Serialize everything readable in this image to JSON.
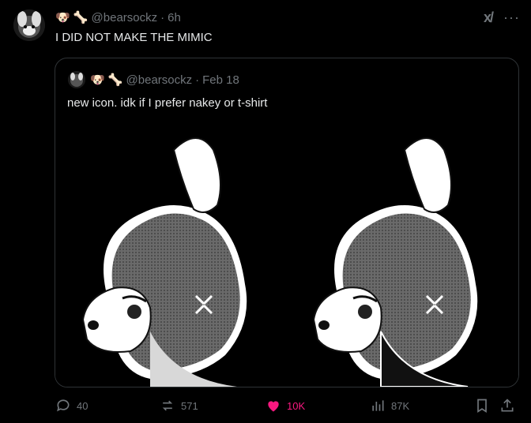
{
  "tweet": {
    "emojis": "🐶 🦴",
    "handle": "@bearsockz",
    "dot": "·",
    "time": "6h",
    "text": "I DID NOT MAKE THE MIMIC"
  },
  "quote": {
    "emojis": "🐶 🦴",
    "handle": "@bearsockz",
    "dot": "·",
    "date": "Feb 18",
    "text": "new icon. idk if I prefer nakey or t-shirt"
  },
  "actions": {
    "replies": "40",
    "reposts": "571",
    "likes": "10K",
    "views": "87K"
  },
  "colors": {
    "background": "#000000",
    "text": "#e7e9ea",
    "muted": "#71767b",
    "like": "#f91880",
    "border": "#2f3336"
  }
}
